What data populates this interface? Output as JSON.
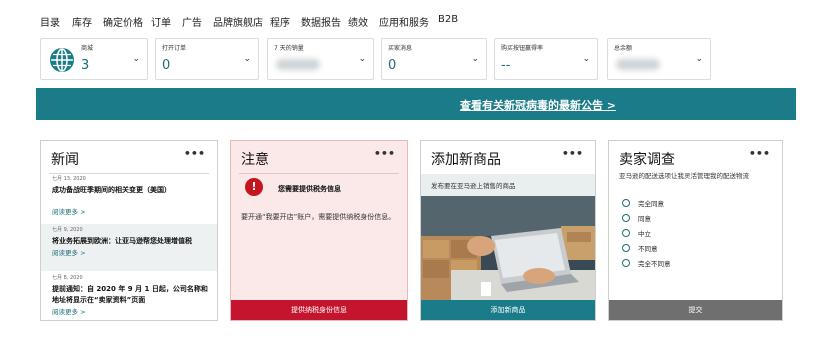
{
  "nav": [
    "目录",
    "库存",
    "确定价格",
    "订单",
    "广告",
    "品牌旗舰店",
    "程序",
    "数据报告",
    "绩效",
    "应用和服务",
    "B2B"
  ],
  "metrics": [
    {
      "label": "商城",
      "value": "3",
      "icon": "globe-icon"
    },
    {
      "label": "打开订单",
      "value": "0"
    },
    {
      "label": "7 天的销量",
      "value": ""
    },
    {
      "label": "买家消息",
      "value": "0"
    },
    {
      "label": "购买按钮赢得率",
      "value": "--"
    },
    {
      "label": "总余额",
      "value": ""
    }
  ],
  "banner": {
    "link": "查看有关新冠病毒的最新公告 >"
  },
  "news": {
    "title": "新闻",
    "more": "•••",
    "items": [
      {
        "date": "七月 13, 2020",
        "headline": "成功备战旺季期间的相关变更（美国）",
        "read": "阅读更多 >"
      },
      {
        "date": "七月 9, 2020",
        "headline": "将业务拓展到欧洲：让亚马逊帮您处理增值税",
        "read": "阅读更多 >"
      },
      {
        "date": "七月 8, 2020",
        "headline": "提前通知：自 2020 年 9 月 1 日起，公司名称和地址将显示在“卖家资料”页面",
        "read": "阅读更多 >"
      }
    ]
  },
  "notice": {
    "title": "注意",
    "more": "•••",
    "icon": "!",
    "heading": "您需要提供税务信息",
    "body": "要开通“我要开店”账户，需要提供纳税身份信息。",
    "button": "提供纳税身份信息"
  },
  "add_product": {
    "title": "添加新商品",
    "more": "•••",
    "subtitle": "发布要在亚马逊上销售的商品",
    "button": "添加新商品"
  },
  "survey": {
    "title": "卖家调查",
    "more": "•••",
    "question": "亚马逊的配送选项让我灵活管理我的配送物流",
    "options": [
      "完全同意",
      "同意",
      "中立",
      "不同意",
      "完全不同意"
    ],
    "button": "提交"
  },
  "colors": {
    "teal": "#1a7b89",
    "alert_red": "#c3161f",
    "notice_bg": "#fbe9e9",
    "submit_gray": "#6f6f6f"
  }
}
